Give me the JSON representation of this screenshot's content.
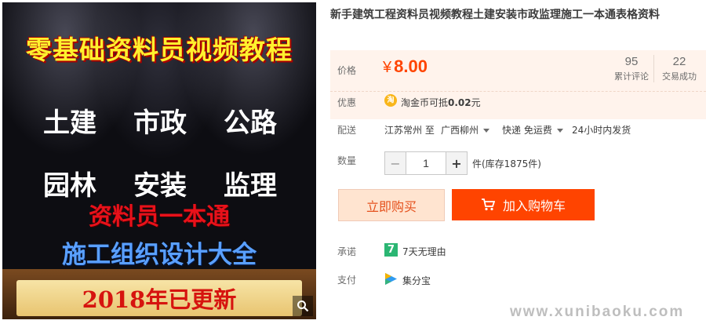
{
  "product_image": {
    "headline": "零基础资料员视频教程",
    "grid": [
      [
        "土建",
        "市政",
        "公路"
      ],
      [
        "园林",
        "安装",
        "监理"
      ]
    ],
    "line1": "资料员一本通",
    "line2": "施工组织设计大全",
    "banner": "2018年已更新"
  },
  "title": "新手建筑工程资料员视频教程土建安装市政监理施工一本通表格资料",
  "price": {
    "label": "价格",
    "currency": "¥",
    "value": "8.00"
  },
  "stats": {
    "reviews": {
      "count": "95",
      "label": "累计评论"
    },
    "trades": {
      "count": "22",
      "label": "交易成功"
    }
  },
  "promo": {
    "label": "优惠",
    "icon_text": "淘",
    "prefix": "淘金币可抵",
    "amount": "0.02",
    "unit": "元"
  },
  "shipping": {
    "label": "配送",
    "from": "江苏常州 至",
    "to": "广西柳州",
    "method": "快递 免运费",
    "dispatch": "24小时内发货"
  },
  "quantity": {
    "label": "数量",
    "value": "1",
    "minus": "−",
    "plus": "+",
    "stock": "件(库存1875件)"
  },
  "actions": {
    "buy_now": "立即购买",
    "add_to_cart": "加入购物车"
  },
  "promise": {
    "label": "承诺",
    "badge": "7",
    "text": "7天无理由"
  },
  "payment": {
    "label": "支付",
    "text": "集分宝"
  },
  "watermark": "www.xunibaoku.com",
  "colors": {
    "accent": "#ff4400",
    "price_bg": "#fff3ec",
    "buy_now_bg": "#ffe4d0"
  }
}
